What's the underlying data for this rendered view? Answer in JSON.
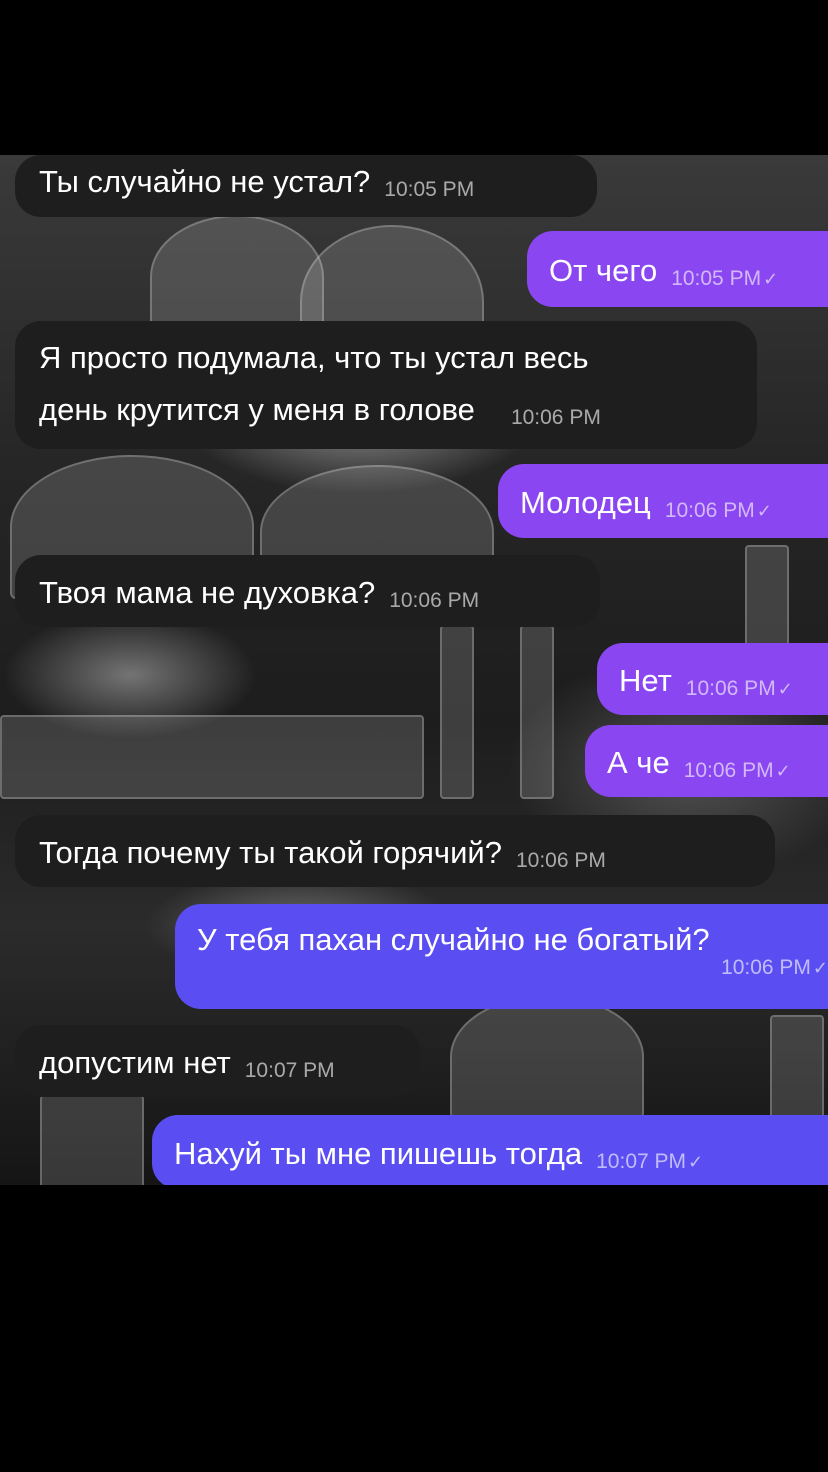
{
  "messages": [
    {
      "direction": "in",
      "text": "Ты случайно не устал?",
      "time": "10:05 PM"
    },
    {
      "direction": "out",
      "text": "От чего",
      "time": "10:05 PM",
      "status": "✓"
    },
    {
      "direction": "in",
      "text_line1": "Я просто подумала, что ты устал весь",
      "text_line2": "день крутится у меня в голове",
      "time": "10:06 PM"
    },
    {
      "direction": "out",
      "text": "Молодец",
      "time": "10:06 PM",
      "status": "✓"
    },
    {
      "direction": "in",
      "text": "Твоя мама не духовка?",
      "time": "10:06 PM"
    },
    {
      "direction": "out",
      "text": "Нет",
      "time": "10:06 PM",
      "status": "✓"
    },
    {
      "direction": "out",
      "text": "А че",
      "time": "10:06 PM",
      "status": "✓"
    },
    {
      "direction": "in",
      "text": "Тогда почему ты такой горячий?",
      "time": "10:06 PM"
    },
    {
      "direction": "out",
      "text": "У тебя пахан случайно не богатый?",
      "time": "10:06 PM",
      "status": "✓"
    },
    {
      "direction": "in",
      "text": "допустим нет",
      "time": "10:07 PM"
    },
    {
      "direction": "out",
      "text": "Нахуй ты мне пишешь тогда",
      "time": "10:07 PM",
      "status": "✓"
    }
  ],
  "colors": {
    "incoming_bubble": "#1e1e1e",
    "outgoing_purple": "#8a46f0",
    "outgoing_blue": "#5a4ef2",
    "screen_background": "#000000"
  }
}
